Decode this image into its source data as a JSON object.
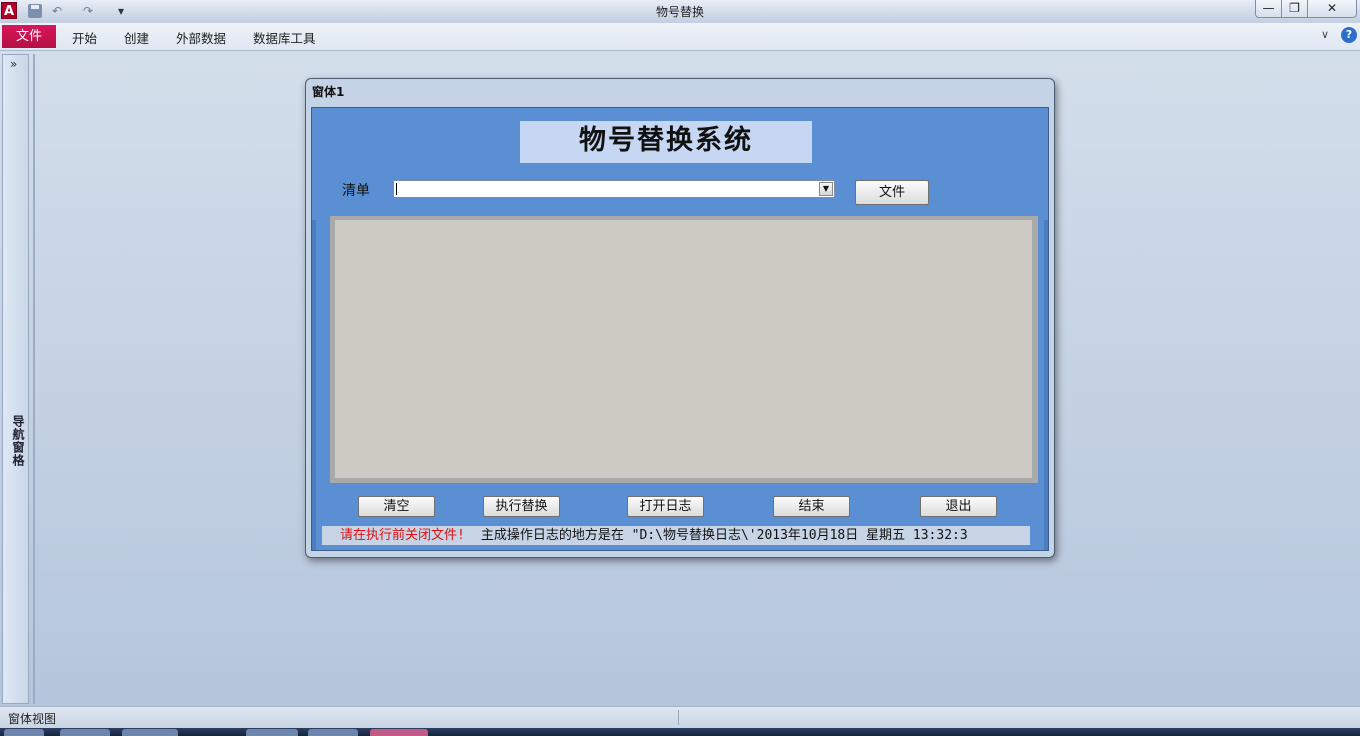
{
  "window": {
    "title": "物号替换",
    "app_icon": "A",
    "qat": {
      "undo": "↶",
      "redo": "↷",
      "customize": "▾"
    },
    "controls": {
      "minimize": "—",
      "maximize": "❐",
      "close": "✕"
    }
  },
  "ribbon": {
    "file_tab": "文件",
    "tabs": [
      "开始",
      "创建",
      "外部数据",
      "数据库工具"
    ],
    "caret": "∨",
    "help": "?"
  },
  "nav_pane": {
    "toggle": "»",
    "label": "导航窗格"
  },
  "form": {
    "caption": "窗体1",
    "system_title": "物号替换系统",
    "list_label": "清单",
    "combo": {
      "value": "",
      "caret": "▼"
    },
    "file_button": "文件",
    "buttons": {
      "clear": "清空",
      "execute": "执行替换",
      "open_log": "打开日志",
      "end": "结束",
      "exit": "退出"
    },
    "status_warning": "请在执行前关闭文件!",
    "status_info": "主成操作日志的地方是在 \"D:\\物号替换日志\\'2013年10月18日 星期五 13:32:3"
  },
  "statusbar": {
    "view_name": "窗体视图"
  },
  "colors": {
    "file_tab": "#c8104f",
    "form_body": "#5b8fd3",
    "warning_text": "#e01010"
  }
}
